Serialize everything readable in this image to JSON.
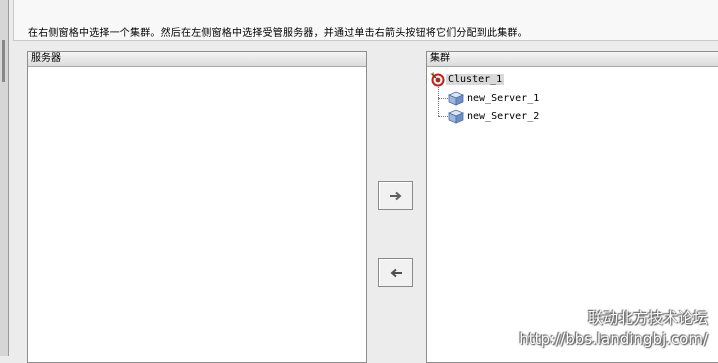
{
  "instruction": "在右侧窗格中选择一个集群。然后在左侧窗格中选择受管服务器，并通过单击右箭头按钮将它们分配到此集群。",
  "servers_pane": {
    "header": "服务器"
  },
  "cluster_pane": {
    "header": "集群",
    "root": {
      "label": "Cluster_1",
      "icon": "cluster-icon"
    },
    "children": [
      {
        "label": "new_Server_1",
        "icon": "server-icon"
      },
      {
        "label": "new_Server_2",
        "icon": "server-icon"
      }
    ]
  },
  "buttons": {
    "add": "➜",
    "remove": "⬅"
  },
  "watermark": {
    "line1": "联动北方技术论坛",
    "line2": "http://bbs.landingbj.com/"
  }
}
